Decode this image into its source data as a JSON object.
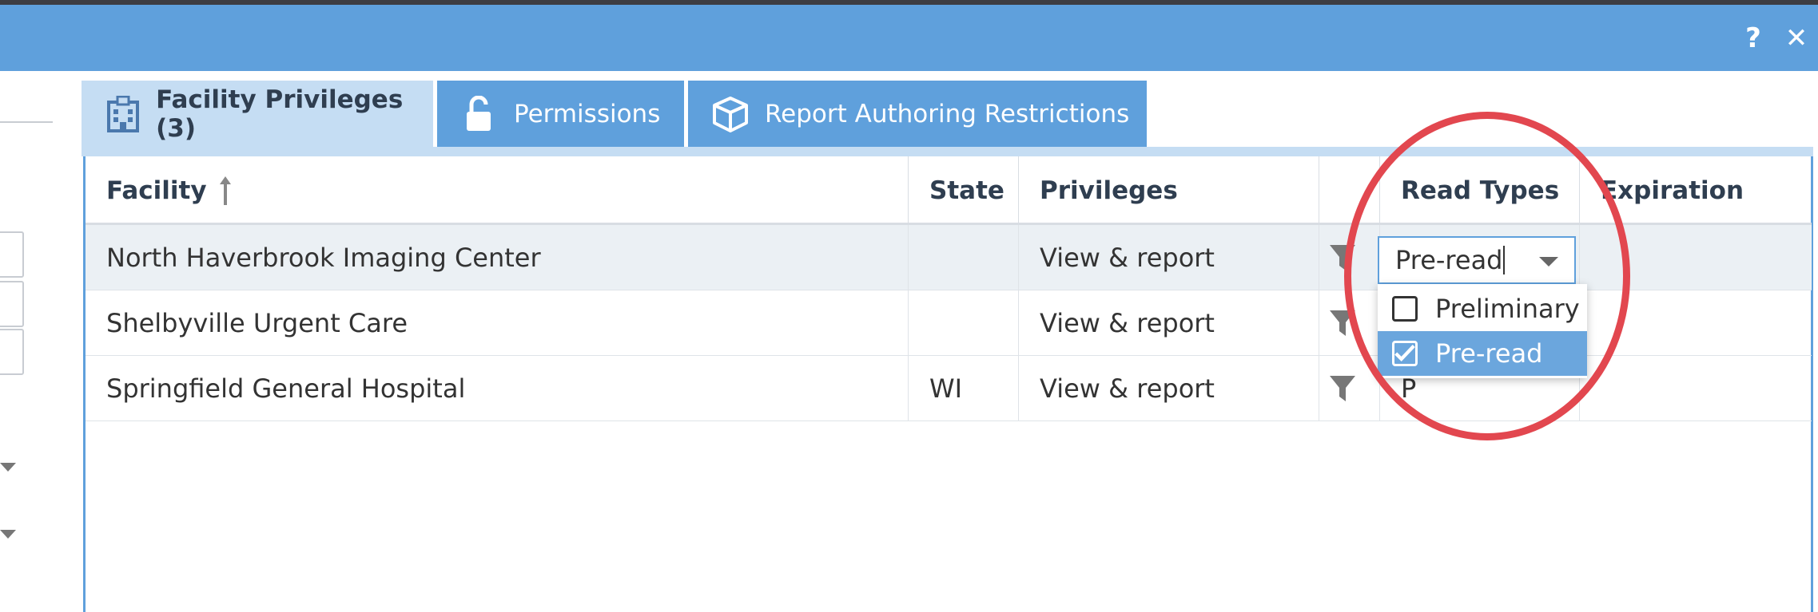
{
  "window": {
    "help_label": "?",
    "close_label": "✕"
  },
  "tabs": [
    {
      "label": "Facility Privileges (3)",
      "icon": "hospital-icon",
      "active": true
    },
    {
      "label": "Permissions",
      "icon": "unlock-icon",
      "active": false
    },
    {
      "label": "Report Authoring Restrictions",
      "icon": "box-icon",
      "active": false
    }
  ],
  "grid": {
    "columns": [
      "Facility",
      "State",
      "Privileges",
      "",
      "Read Types",
      "Expiration"
    ],
    "sort": {
      "column": "Facility",
      "direction": "ascending",
      "icon": "sort-up-arrow-icon"
    },
    "rows": [
      {
        "facility": "North Haverbrook Imaging Center",
        "state": "",
        "privileges": "View & report",
        "read_types": "Pre-read",
        "expiration": ""
      },
      {
        "facility": "Shelbyville Urgent Care",
        "state": "",
        "privileges": "View & report",
        "read_types": "",
        "expiration": ""
      },
      {
        "facility": "Springfield General Hospital",
        "state": "WI",
        "privileges": "View & report",
        "read_types": "P",
        "expiration": ""
      }
    ]
  },
  "read_types_editor": {
    "value": "Pre-read",
    "options": [
      {
        "label": "Preliminary",
        "checked": false
      },
      {
        "label": "Pre-read",
        "checked": true
      }
    ]
  },
  "colors": {
    "title_bar": "#5fa0dc",
    "active_tab": "#c5ddf3",
    "selected_option": "#6ba6dd",
    "annotation": "#e2474f"
  }
}
